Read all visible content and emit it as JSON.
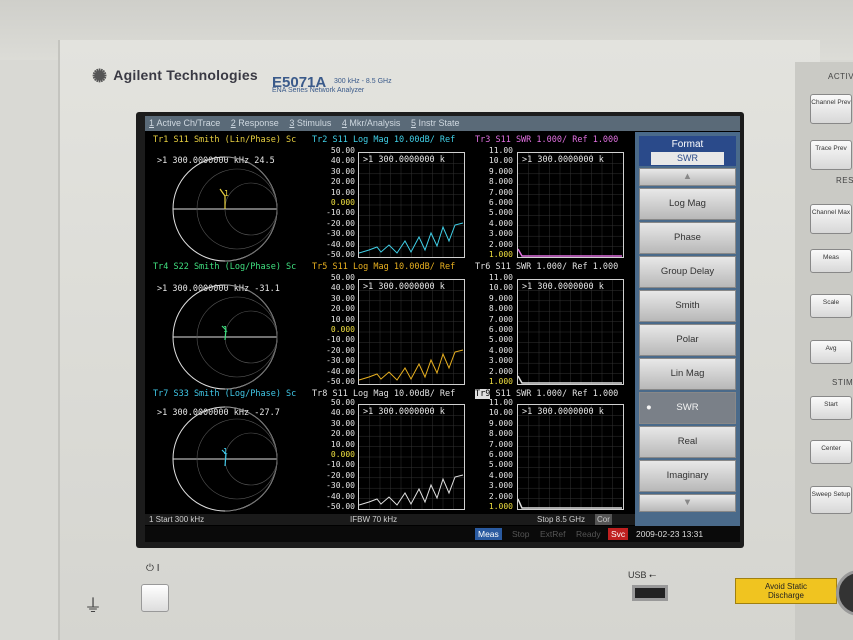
{
  "brand": "Agilent Technologies",
  "model": "E5071A",
  "model_sub_1": "300 kHz - 8.5 GHz",
  "model_sub_2": "ENA Series  Network Analyzer",
  "menu": [
    {
      "num": "1",
      "label": "Active Ch/Trace"
    },
    {
      "num": "2",
      "label": "Response"
    },
    {
      "num": "3",
      "label": "Stimulus"
    },
    {
      "num": "4",
      "label": "Mkr/Analysis"
    },
    {
      "num": "5",
      "label": "Instr State"
    }
  ],
  "traces": {
    "tr1": {
      "title": "Tr1  S11  Smith (Lin/Phase) Sc",
      "marker": ">1   300.0000000 kHz  24.5",
      "color": "#e8d040"
    },
    "tr2": {
      "title": "Tr2  S11  Log Mag 10.00dB/ Ref",
      "marker": ">1   300.0000000  k",
      "color": "#40d0e8"
    },
    "tr3": {
      "title": "Tr3  S11  SWR 1.000/ Ref 1.000",
      "marker": ">1   300.0000000  k",
      "color": "#e070e0"
    },
    "tr4": {
      "title": "Tr4  S22  Smith (Log/Phase) Sc",
      "marker": ">1   300.0000000 kHz  -31.1",
      "color": "#40e080"
    },
    "tr5": {
      "title": "Tr5  S11  Log Mag 10.00dB/ Ref",
      "marker": ">1   300.0000000  k",
      "color": "#e8b020"
    },
    "tr6": {
      "title": "Tr6  S11  SWR 1.000/ Ref 1.000",
      "marker": ">1   300.0000000  k",
      "color": "#e0e0e0"
    },
    "tr7": {
      "title": "Tr7  S33  Smith (Log/Phase) Sc",
      "marker": ">1   300.0000000 kHz  -27.7",
      "color": "#40c8e8"
    },
    "tr8": {
      "title": "Tr8  S11  Log Mag 10.00dB/ Ref",
      "marker": ">1   300.0000000  k",
      "color": "#e0e0e0"
    },
    "tr9": {
      "title": "S11  SWR 1.000/ Ref 1.000",
      "tr9_badge": "Tr9",
      "marker": ">1   300.0000000  k",
      "color": "#e0e0e0"
    }
  },
  "logmag_ticks": [
    "50.00",
    "40.00",
    "30.00",
    "20.00",
    "10.00",
    "0.000",
    "-10.00",
    "-20.00",
    "-30.00",
    "-40.00",
    "-50.00"
  ],
  "swr_ticks_top": [
    "11.00",
    "10.00",
    "9.000",
    "8.000",
    "7.000",
    "6.000",
    "5.000",
    "4.000",
    "3.000",
    "2.000",
    "1.000"
  ],
  "status_line": {
    "start": "1  Start 300 kHz",
    "ifbw": "IFBW 70 kHz",
    "stop": "Stop 8.5 GHz",
    "cor": "Cor"
  },
  "softkeys": {
    "title": "Format",
    "title_value": "SWR",
    "items": [
      "Log Mag",
      "Phase",
      "Group Delay",
      "Smith",
      "Polar",
      "Lin Mag",
      "SWR",
      "Real",
      "Imaginary"
    ],
    "selected": "SWR"
  },
  "bottom_status": {
    "meas": "Meas",
    "stop": "Stop",
    "extref": "ExtRef",
    "ready": "Ready",
    "svc": "Svc",
    "datetime": "2009-02-23 13:31"
  },
  "hardware": {
    "section_active": "ACTIVE",
    "channel_prev": "Channel Prev",
    "trace_prev": "Trace Prev",
    "section_response": "RES",
    "channel_max": "Channel Max",
    "meas": "Meas",
    "scale": "Scale",
    "avg": "Avg",
    "section_stimulus": "STIM",
    "start": "Start",
    "center": "Center",
    "sweep_setup": "Sweep Setup",
    "usb": "USB",
    "warning_line1": "Avoid Static",
    "warning_line2": "Discharge"
  }
}
